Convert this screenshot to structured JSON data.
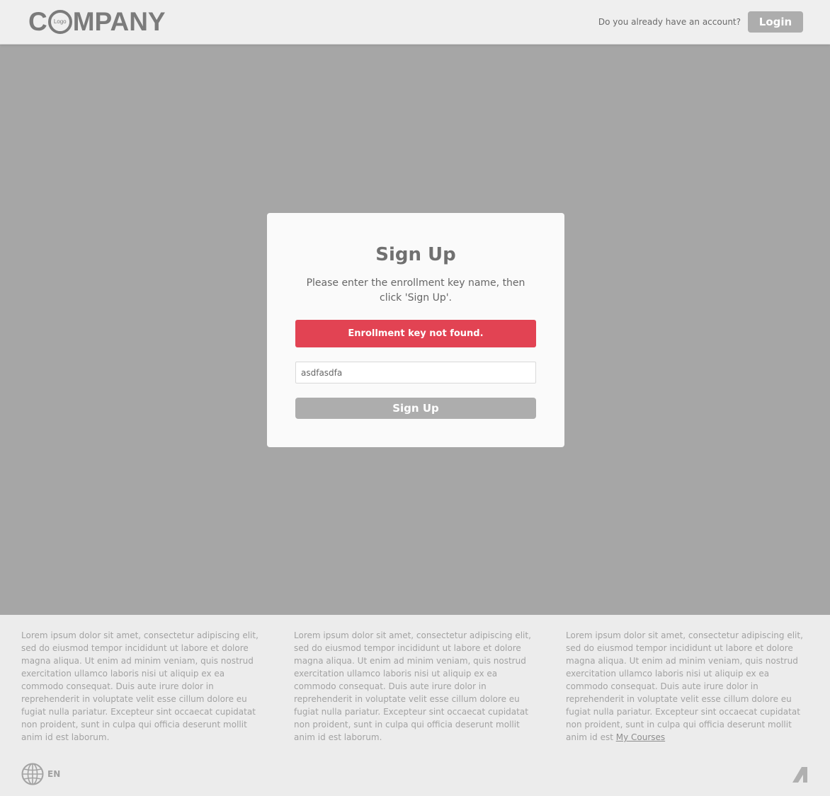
{
  "header": {
    "logo_prefix": "C",
    "logo_circle_text": "Logo",
    "logo_suffix": "MPANY",
    "account_question": "Do you already have an account?",
    "login_label": "Login"
  },
  "signup": {
    "title": "Sign Up",
    "description": "Please enter the enrollment key name, then click 'Sign Up'.",
    "error": "Enrollment key not found.",
    "key_value": "asdfasdfa",
    "button_label": "Sign Up"
  },
  "footer": {
    "col1": "Lorem ipsum dolor sit amet, consectetur adipiscing elit, sed do eiusmod tempor incididunt ut labore et dolore magna aliqua. Ut enim ad minim veniam, quis nostrud exercitation ullamco laboris nisi ut aliquip ex ea commodo consequat. Duis aute irure dolor in reprehenderit in voluptate velit esse cillum dolore eu fugiat nulla pariatur. Excepteur sint occaecat cupidatat non proident, sunt in culpa qui officia deserunt mollit anim id est laborum.",
    "col2": "Lorem ipsum dolor sit amet, consectetur adipiscing elit, sed do eiusmod tempor incididunt ut labore et dolore magna aliqua. Ut enim ad minim veniam, quis nostrud exercitation ullamco laboris nisi ut aliquip ex ea commodo consequat. Duis aute irure dolor in reprehenderit in voluptate velit esse cillum dolore eu fugiat nulla pariatur. Excepteur sint occaecat cupidatat non proident, sunt in culpa qui officia deserunt mollit anim id est laborum.",
    "col3": "Lorem ipsum dolor sit amet, consectetur adipiscing elit, sed do eiusmod tempor incididunt ut labore et dolore magna aliqua. Ut enim ad minim veniam, quis nostrud exercitation ullamco laboris nisi ut aliquip ex ea commodo consequat. Duis aute irure dolor in reprehenderit in voluptate velit esse cillum dolore eu fugiat nulla pariatur. Excepteur sint occaecat cupidatat non proident, sunt in culpa qui officia deserunt mollit anim id est",
    "col3_link": "My Courses",
    "language": "EN"
  },
  "icons": {
    "language": "globe-icon",
    "brand": "brand-mark-icon"
  },
  "colors": {
    "error": "#e24353",
    "button": "#adadad",
    "backdrop": "#a6a6a6"
  }
}
